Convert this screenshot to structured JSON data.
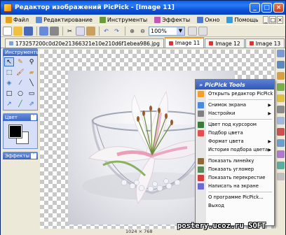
{
  "window": {
    "title": "Редактор изображений PicPick - [Image 11]",
    "controls": [
      "_",
      "□",
      "×"
    ]
  },
  "menubar": {
    "items": [
      {
        "label": "Файл",
        "icon": "file-icon",
        "color": "#e8a020"
      },
      {
        "label": "Редактирование",
        "icon": "edit-icon",
        "color": "#5a8ad8"
      },
      {
        "label": "Инструменты",
        "icon": "tools-icon",
        "color": "#6a9a3a"
      },
      {
        "label": "Эффекты",
        "icon": "effects-icon",
        "color": "#c05ab0"
      },
      {
        "label": "Окно",
        "icon": "window-icon",
        "color": "#4a7ad0"
      },
      {
        "label": "Помощь",
        "icon": "help-icon",
        "color": "#3a9ad8"
      }
    ]
  },
  "toolbar": {
    "zoom_value": "100%"
  },
  "tabs": [
    {
      "label": "173257200c0d20e21366321e10e210d6f1ebea986.jpg",
      "active": false
    },
    {
      "label": "Image 11",
      "active": true
    },
    {
      "label": "Image 12",
      "active": false
    },
    {
      "label": "Image 13",
      "active": false
    }
  ],
  "panels": {
    "tools_title": "Инструменты",
    "color_title": "Цвет",
    "effects_title": "Эффекты",
    "foreground_color": "#000000",
    "background_color": "#ffffff"
  },
  "popup": {
    "title": "» PicPick Tools",
    "items": [
      {
        "label": "Открыть редактор PicPick",
        "icon": "picpick-icon",
        "color": "#f0a030",
        "submenu": false
      },
      {
        "type": "sep"
      },
      {
        "label": "Снимок экрана",
        "icon": "capture-icon",
        "color": "#4a88d8",
        "submenu": true
      },
      {
        "label": "Настройки",
        "icon": "settings-icon",
        "color": "#808080",
        "submenu": true
      },
      {
        "type": "sep"
      },
      {
        "label": "Цвет под курсором",
        "icon": "eyedropper-icon",
        "color": "#3a7a3a",
        "submenu": false
      },
      {
        "label": "Подбор цвета",
        "icon": "palette-icon",
        "color": "#e05050",
        "submenu": false
      },
      {
        "label": "Формат цвета",
        "icon": "color-format-icon",
        "color": "#c0c0c0",
        "submenu": true
      },
      {
        "label": "История подбора цвета",
        "icon": "history-icon",
        "color": "#c0c0c0",
        "submenu": true
      },
      {
        "type": "sep"
      },
      {
        "label": "Показать линейку",
        "icon": "ruler-icon",
        "color": "#8a6a3a",
        "submenu": false
      },
      {
        "label": "Показать угломер",
        "icon": "protractor-icon",
        "color": "#5a8a5a",
        "submenu": false
      },
      {
        "label": "Показать перекрестие",
        "icon": "crosshair-icon",
        "color": "#d04040",
        "submenu": false
      },
      {
        "label": "Написать на экране",
        "icon": "whiteboard-icon",
        "color": "#6a6ad0",
        "submenu": false
      },
      {
        "type": "sep"
      },
      {
        "label": "О программе PicPick...",
        "icon": "",
        "color": "",
        "submenu": false
      },
      {
        "label": "Выход",
        "icon": "",
        "color": "",
        "submenu": false
      }
    ]
  },
  "status": {
    "dimensions": "1024 × 768"
  },
  "watermark": "postery.ucoz.ru SOFT"
}
